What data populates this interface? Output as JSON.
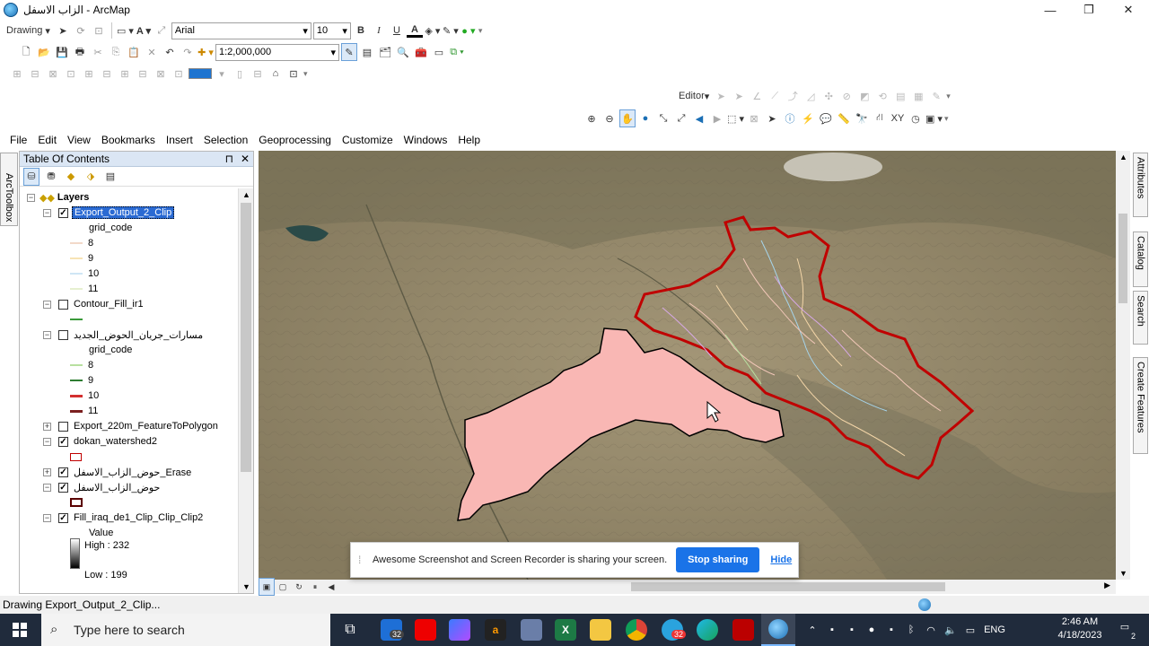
{
  "window": {
    "title": "الزاب الاسفل - ArcMap",
    "minimize": "—",
    "maximize": "❐",
    "close": "✕"
  },
  "draw_toolbar": {
    "drawing_label": "Drawing",
    "font": "Arial",
    "size": "10",
    "bold": "B",
    "italic": "I",
    "underline": "U",
    "font_color": "A"
  },
  "standard_toolbar": {
    "scale": "1:2,000,000"
  },
  "editor": {
    "label": "Editor"
  },
  "menu": [
    "File",
    "Edit",
    "View",
    "Bookmarks",
    "Insert",
    "Selection",
    "Geoprocessing",
    "Customize",
    "Windows",
    "Help"
  ],
  "toc": {
    "title": "Table Of Contents",
    "pin": "⊓",
    "close": "✕",
    "root": "Layers",
    "layers": [
      {
        "name": "Export_Output_2_Clip",
        "checked": true,
        "selected": true
      },
      {
        "name": "Contour_Fill_ir1",
        "checked": false
      },
      {
        "name": "مسارات_جريان_الحوض_الجديد",
        "checked": false
      },
      {
        "name": "Export_220m_FeatureToPolygon",
        "checked": false
      },
      {
        "name": "dokan_watershed2",
        "checked": true
      },
      {
        "name": "حوض_الزاب_الاسفل_Erase",
        "checked": true
      },
      {
        "name": "حوض_الزاب_الاسفل",
        "checked": true
      },
      {
        "name": "Fill_iraq_de1_Clip_Clip_Clip2",
        "checked": true
      }
    ],
    "field1": "grid_code",
    "classes1": [
      "8",
      "9",
      "10",
      "11"
    ],
    "field2": "grid_code",
    "classes2": [
      "8",
      "9",
      "10",
      "11"
    ],
    "value_label": "Value",
    "high": "High : 232",
    "low": "Low : 199",
    "colors": {
      "c8": "#b8e0a0",
      "c9": "#2e7d32",
      "c10": "#d32f2f",
      "c11": "#7b1f1f"
    }
  },
  "side_tabs": {
    "left": "ArcToolbox",
    "right": [
      "Attributes",
      "Catalog",
      "Search",
      "Create Features"
    ]
  },
  "status": {
    "text": "Drawing Export_Output_2_Clip..."
  },
  "share": {
    "message": "Awesome Screenshot and Screen Recorder is sharing your screen.",
    "stop": "Stop sharing",
    "hide": "Hide"
  },
  "taskbar": {
    "search_placeholder": "Type here to search",
    "lang": "ENG",
    "time": "2:46 AM",
    "date": "4/18/2023",
    "mail_badge": "32",
    "telegram_badge": "32",
    "notif": "2"
  },
  "colors": {
    "accent": "#1a73e8",
    "watershed_fill": "#f9b7b4",
    "watershed_outline": "#c00000",
    "map_base": "#9b8f70"
  }
}
